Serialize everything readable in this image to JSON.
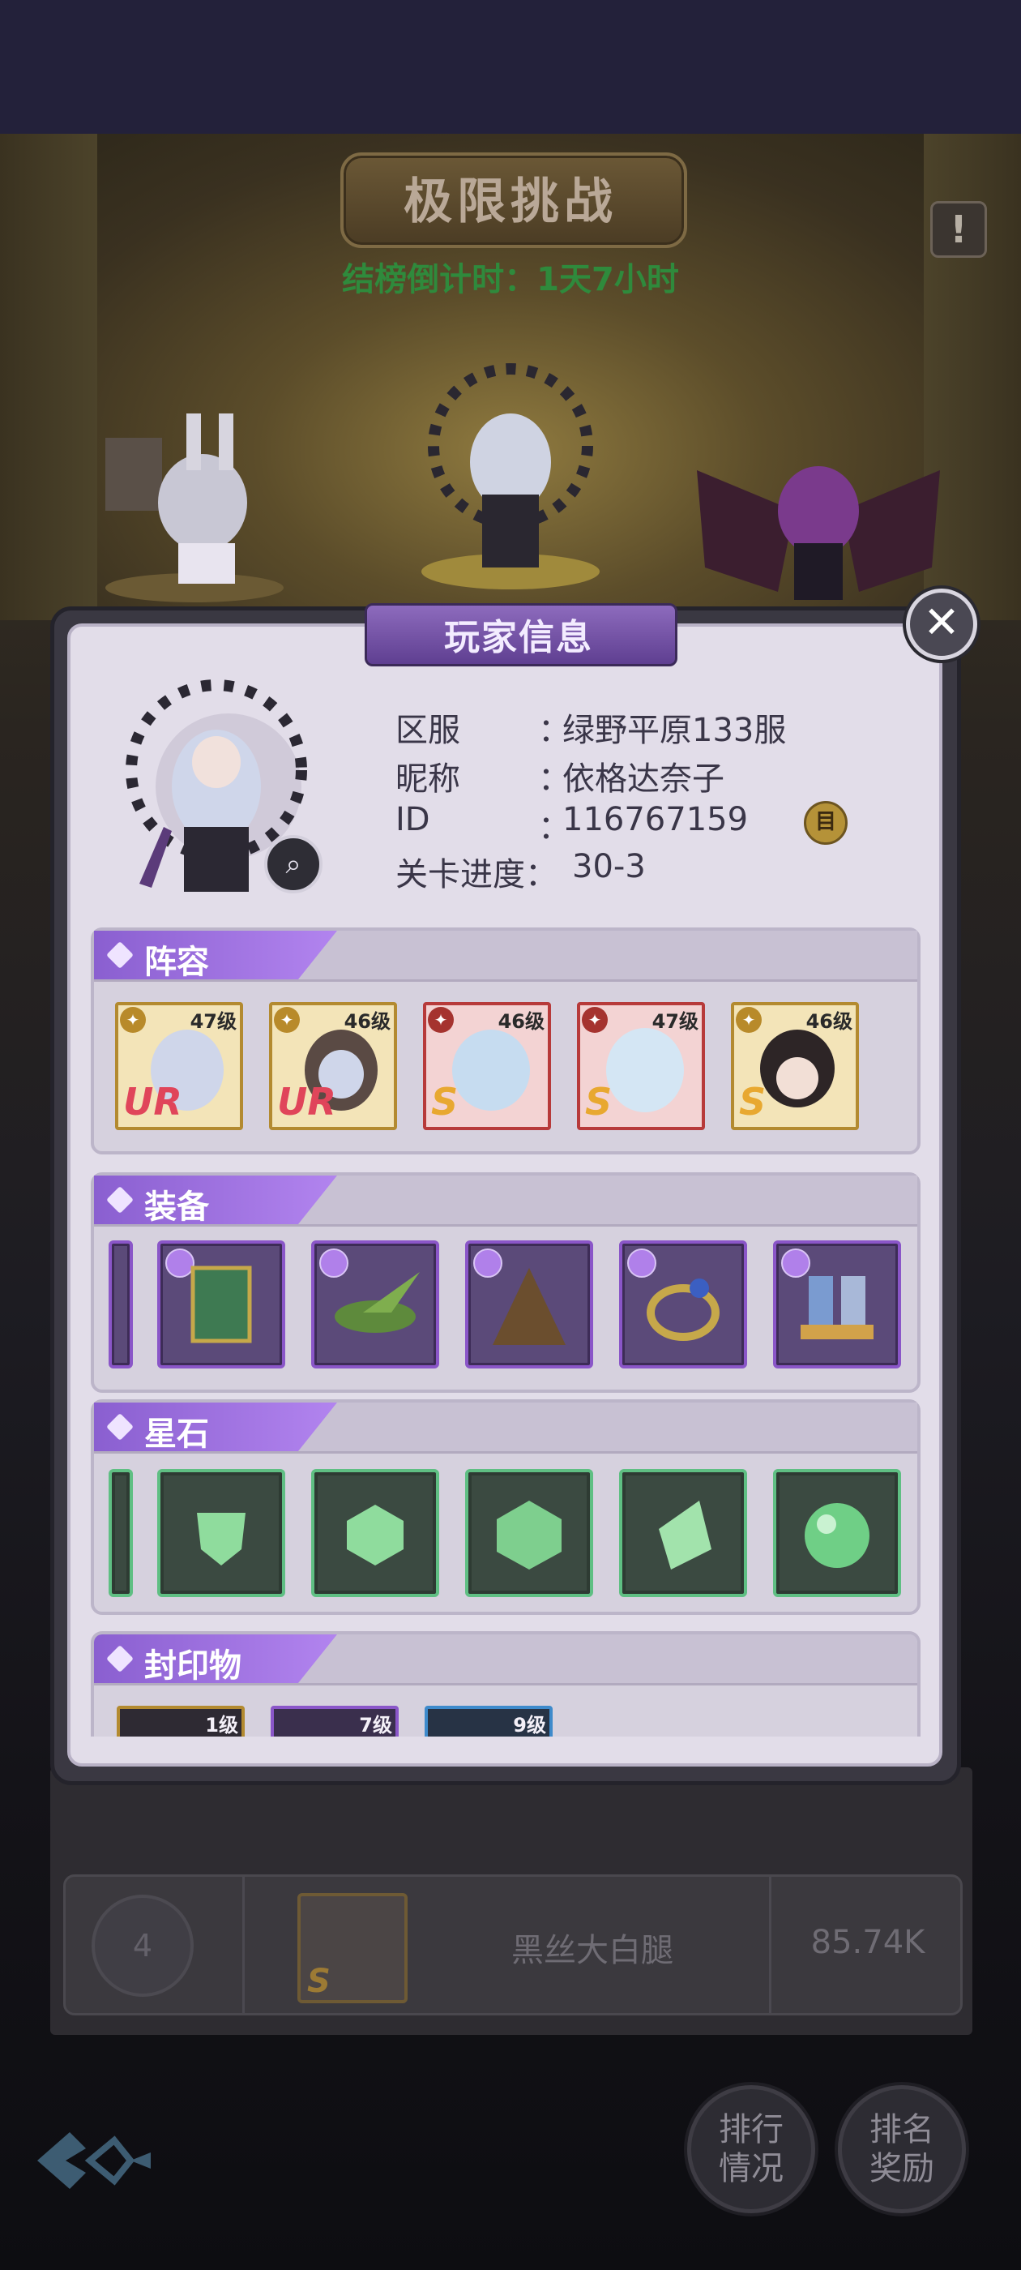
{
  "background": {
    "title": "极限挑战",
    "countdown": "结榜倒计时：1天7小时",
    "alert_glyph": "!",
    "row": {
      "rank": "4",
      "name": "黑丝大白腿",
      "score": "85.74K",
      "avatar_rank": "S"
    },
    "buttons": {
      "ranking": [
        "排行",
        "情况"
      ],
      "reward": [
        "排名",
        "奖励"
      ]
    }
  },
  "dialog": {
    "title": "玩家信息",
    "close_glyph": "✕",
    "info": [
      {
        "label": "区服",
        "value": "绿野平原133服"
      },
      {
        "label": "昵称",
        "value": "依格达奈子"
      },
      {
        "label": "ID",
        "value": "116767159"
      }
    ],
    "colon": "：",
    "progress_label": "关卡进度：",
    "progress_value": "30-3",
    "copy_glyph": "目",
    "search_icon": "magnifier-icon",
    "sections": {
      "lineup": {
        "title": "阵容",
        "heroes": [
          {
            "level": "47级",
            "rank": "UR",
            "rank_color": "#e0455a",
            "frame": "gold"
          },
          {
            "level": "46级",
            "rank": "UR",
            "rank_color": "#e0455a",
            "frame": "gold"
          },
          {
            "level": "46级",
            "rank": "S",
            "rank_color": "#e8a830",
            "frame": "red"
          },
          {
            "level": "47级",
            "rank": "S",
            "rank_color": "#e8a830",
            "frame": "red"
          },
          {
            "level": "46级",
            "rank": "S",
            "rank_color": "#e8a830",
            "frame": "gold"
          }
        ]
      },
      "equipment": {
        "title": "装备",
        "items": [
          "spellbook-icon",
          "feather-hat-icon",
          "cloak-icon",
          "ring-icon",
          "boots-icon"
        ]
      },
      "stones": {
        "title": "星石",
        "items": [
          "shield-gem-icon",
          "round-gem-icon",
          "hex-gem-icon",
          "shard-gem-icon",
          "orb-gem-icon"
        ]
      },
      "seals": {
        "title": "封印物",
        "items": [
          {
            "level": "1级",
            "frame": "gold"
          },
          {
            "level": "7级",
            "frame": "purple"
          },
          {
            "level": "9级",
            "frame": "blue"
          }
        ]
      }
    }
  },
  "colors": {
    "accent_purple": "#9a6ad8",
    "countdown_green": "#2f8a3c",
    "panel_bg": "#e2dde9"
  }
}
